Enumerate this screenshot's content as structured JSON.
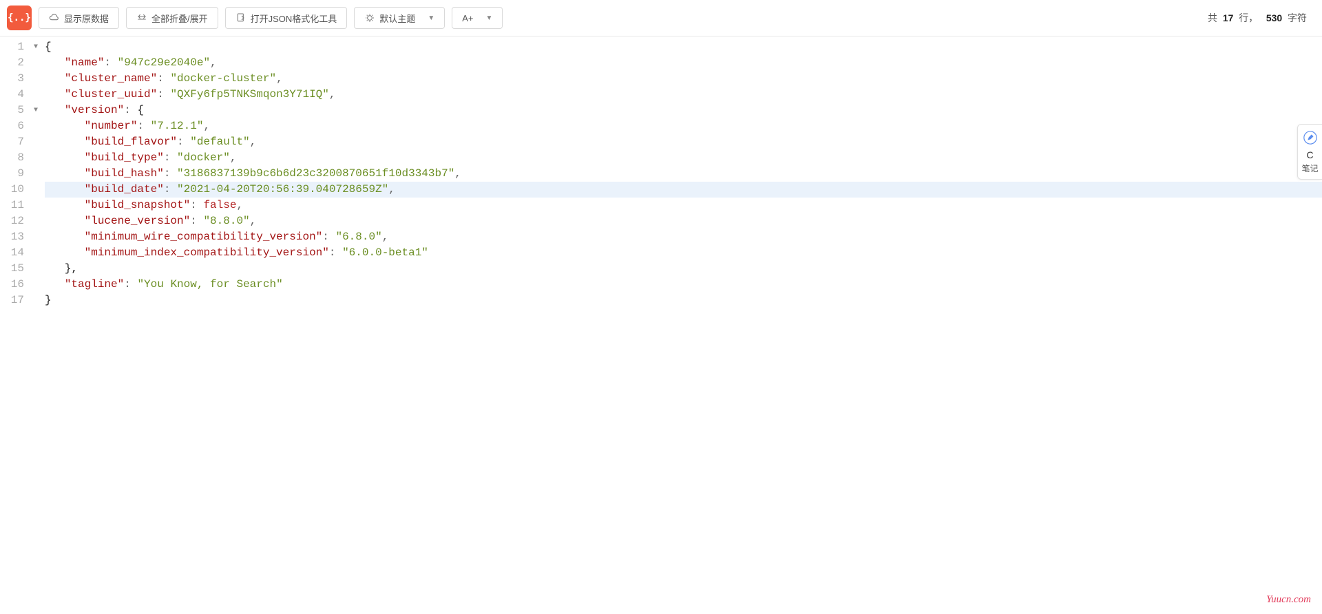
{
  "toolbar": {
    "logo_text": "{..}",
    "show_raw": "显示原数据",
    "fold_expand": "全部折叠/展开",
    "open_tool": "打开JSON格式化工具",
    "theme": "默认主题",
    "font_button": "A+"
  },
  "stats": {
    "prefix": "共",
    "lines": "17",
    "lines_label": "行，",
    "chars": "530",
    "chars_label": "字符"
  },
  "code_lines": [
    {
      "n": 1,
      "fold": true,
      "tokens": [
        {
          "t": "{",
          "c": "k-brace"
        }
      ]
    },
    {
      "n": 2,
      "indent": 1,
      "tokens": [
        {
          "t": "\"name\"",
          "c": "k-key"
        },
        {
          "t": ": ",
          "c": "k-punc"
        },
        {
          "t": "\"947c29e2040e\"",
          "c": "k-str"
        },
        {
          "t": ",",
          "c": "k-punc"
        }
      ]
    },
    {
      "n": 3,
      "indent": 1,
      "tokens": [
        {
          "t": "\"cluster_name\"",
          "c": "k-key"
        },
        {
          "t": ": ",
          "c": "k-punc"
        },
        {
          "t": "\"docker-cluster\"",
          "c": "k-str"
        },
        {
          "t": ",",
          "c": "k-punc"
        }
      ]
    },
    {
      "n": 4,
      "indent": 1,
      "tokens": [
        {
          "t": "\"cluster_uuid\"",
          "c": "k-key"
        },
        {
          "t": ": ",
          "c": "k-punc"
        },
        {
          "t": "\"QXFy6fp5TNKSmqon3Y71IQ\"",
          "c": "k-str"
        },
        {
          "t": ",",
          "c": "k-punc"
        }
      ]
    },
    {
      "n": 5,
      "indent": 1,
      "fold": true,
      "tokens": [
        {
          "t": "\"version\"",
          "c": "k-key"
        },
        {
          "t": ": ",
          "c": "k-punc"
        },
        {
          "t": "{",
          "c": "k-brace"
        }
      ]
    },
    {
      "n": 6,
      "indent": 2,
      "tokens": [
        {
          "t": "\"number\"",
          "c": "k-key"
        },
        {
          "t": ": ",
          "c": "k-punc"
        },
        {
          "t": "\"7.12.1\"",
          "c": "k-str"
        },
        {
          "t": ",",
          "c": "k-punc"
        }
      ]
    },
    {
      "n": 7,
      "indent": 2,
      "tokens": [
        {
          "t": "\"build_flavor\"",
          "c": "k-key"
        },
        {
          "t": ": ",
          "c": "k-punc"
        },
        {
          "t": "\"default\"",
          "c": "k-str"
        },
        {
          "t": ",",
          "c": "k-punc"
        }
      ]
    },
    {
      "n": 8,
      "indent": 2,
      "tokens": [
        {
          "t": "\"build_type\"",
          "c": "k-key"
        },
        {
          "t": ": ",
          "c": "k-punc"
        },
        {
          "t": "\"docker\"",
          "c": "k-str"
        },
        {
          "t": ",",
          "c": "k-punc"
        }
      ]
    },
    {
      "n": 9,
      "indent": 2,
      "tokens": [
        {
          "t": "\"build_hash\"",
          "c": "k-key"
        },
        {
          "t": ": ",
          "c": "k-punc"
        },
        {
          "t": "\"3186837139b9c6b6d23c3200870651f10d3343b7\"",
          "c": "k-str"
        },
        {
          "t": ",",
          "c": "k-punc"
        }
      ]
    },
    {
      "n": 10,
      "indent": 2,
      "hl": true,
      "tokens": [
        {
          "t": "\"build_date\"",
          "c": "k-key"
        },
        {
          "t": ": ",
          "c": "k-punc"
        },
        {
          "t": "\"2021-04-20T20:56:39.040728659Z\"",
          "c": "k-str"
        },
        {
          "t": ",",
          "c": "k-punc"
        }
      ]
    },
    {
      "n": 11,
      "indent": 2,
      "tokens": [
        {
          "t": "\"build_snapshot\"",
          "c": "k-key"
        },
        {
          "t": ": ",
          "c": "k-punc"
        },
        {
          "t": "false",
          "c": "k-bool"
        },
        {
          "t": ",",
          "c": "k-punc"
        }
      ]
    },
    {
      "n": 12,
      "indent": 2,
      "tokens": [
        {
          "t": "\"lucene_version\"",
          "c": "k-key"
        },
        {
          "t": ": ",
          "c": "k-punc"
        },
        {
          "t": "\"8.8.0\"",
          "c": "k-str"
        },
        {
          "t": ",",
          "c": "k-punc"
        }
      ]
    },
    {
      "n": 13,
      "indent": 2,
      "tokens": [
        {
          "t": "\"minimum_wire_compatibility_version\"",
          "c": "k-key"
        },
        {
          "t": ": ",
          "c": "k-punc"
        },
        {
          "t": "\"6.8.0\"",
          "c": "k-str"
        },
        {
          "t": ",",
          "c": "k-punc"
        }
      ]
    },
    {
      "n": 14,
      "indent": 2,
      "tokens": [
        {
          "t": "\"minimum_index_compatibility_version\"",
          "c": "k-key"
        },
        {
          "t": ": ",
          "c": "k-punc"
        },
        {
          "t": "\"6.0.0-beta1\"",
          "c": "k-str"
        }
      ]
    },
    {
      "n": 15,
      "indent": 1,
      "tokens": [
        {
          "t": "},",
          "c": "k-brace"
        }
      ]
    },
    {
      "n": 16,
      "indent": 1,
      "tokens": [
        {
          "t": "\"tagline\"",
          "c": "k-key"
        },
        {
          "t": ": ",
          "c": "k-punc"
        },
        {
          "t": "\"You Know, for Search\"",
          "c": "k-str"
        }
      ]
    },
    {
      "n": 17,
      "tokens": [
        {
          "t": "}",
          "c": "k-brace"
        }
      ]
    }
  ],
  "side": {
    "c": "C",
    "note": "笔记"
  },
  "watermark": "Yuucn.com"
}
